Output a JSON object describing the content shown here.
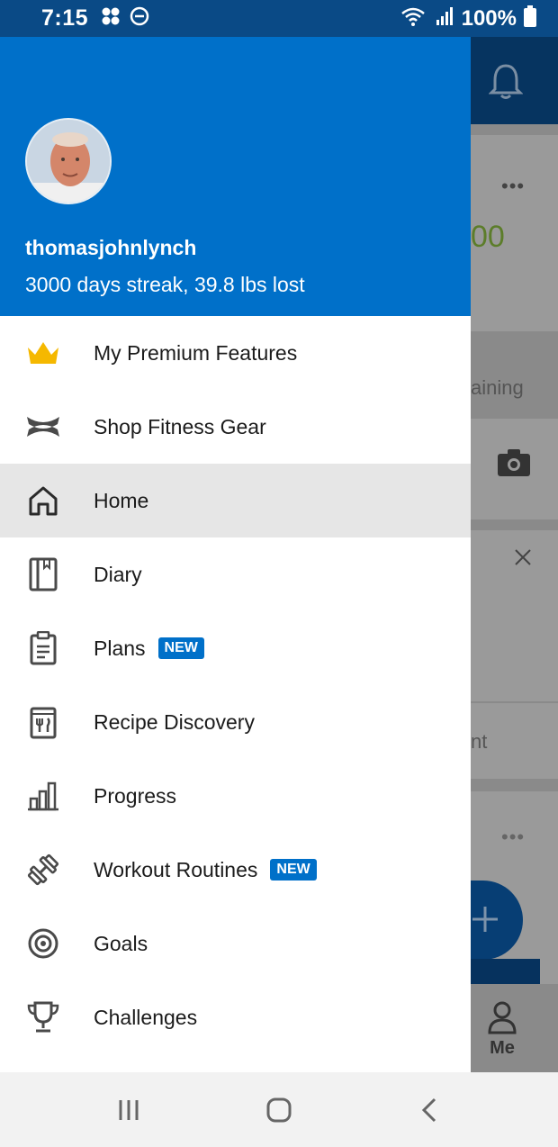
{
  "status_bar": {
    "time": "7:15",
    "battery": "100%"
  },
  "profile": {
    "username": "thomasjohnlynch",
    "streak": "3000 days streak, 39.8 lbs lost"
  },
  "menu": [
    {
      "label": "My Premium Features",
      "icon": "crown-icon",
      "badge": ""
    },
    {
      "label": "Shop Fitness Gear",
      "icon": "under-armour-logo-icon",
      "badge": ""
    },
    {
      "label": "Home",
      "icon": "home-icon",
      "badge": "",
      "active": true
    },
    {
      "label": "Diary",
      "icon": "book-icon",
      "badge": ""
    },
    {
      "label": "Plans",
      "icon": "clipboard-icon",
      "badge": "NEW"
    },
    {
      "label": "Recipe Discovery",
      "icon": "recipe-book-icon",
      "badge": ""
    },
    {
      "label": "Progress",
      "icon": "bar-chart-icon",
      "badge": ""
    },
    {
      "label": "Workout Routines",
      "icon": "dumbbell-icon",
      "badge": "NEW"
    },
    {
      "label": "Goals",
      "icon": "target-icon",
      "badge": ""
    },
    {
      "label": "Challenges",
      "icon": "trophy-icon",
      "badge": ""
    }
  ],
  "background": {
    "value_partial": "00",
    "label_partial": "aining",
    "text_partial": "nt",
    "tab_me": "Me"
  },
  "colors": {
    "primary": "#0070c9",
    "status_bar": "#0a4a86",
    "active_row": "#e6e6e6",
    "crown": "#f5b800"
  }
}
